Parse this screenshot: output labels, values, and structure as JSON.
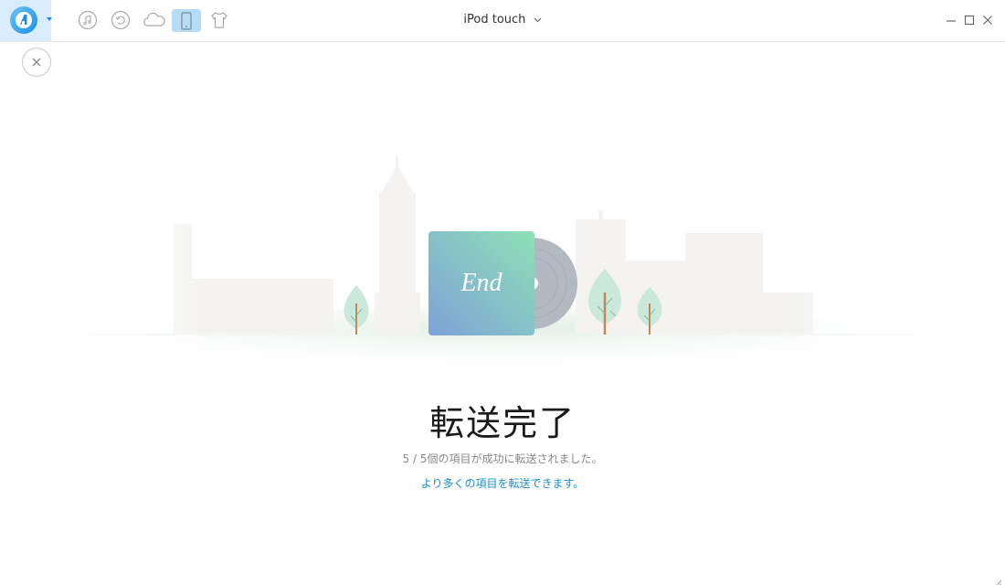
{
  "header": {
    "device_name": "iPod touch"
  },
  "toolbar": {
    "icons": [
      "music-icon",
      "restore-icon",
      "cloud-icon",
      "device-icon",
      "shirt-icon"
    ],
    "active_icon": "device-icon"
  },
  "illustration": {
    "album_text": "End"
  },
  "result": {
    "title": "転送完了",
    "summary": "5 / 5個の項目が成功に転送されました。",
    "more_link": "より多くの項目を転送できます。"
  },
  "colors": {
    "accent": "#1b8fd8",
    "active_tab_bg": "#b7dcf5",
    "logo_bg": "#d9ecfb"
  }
}
